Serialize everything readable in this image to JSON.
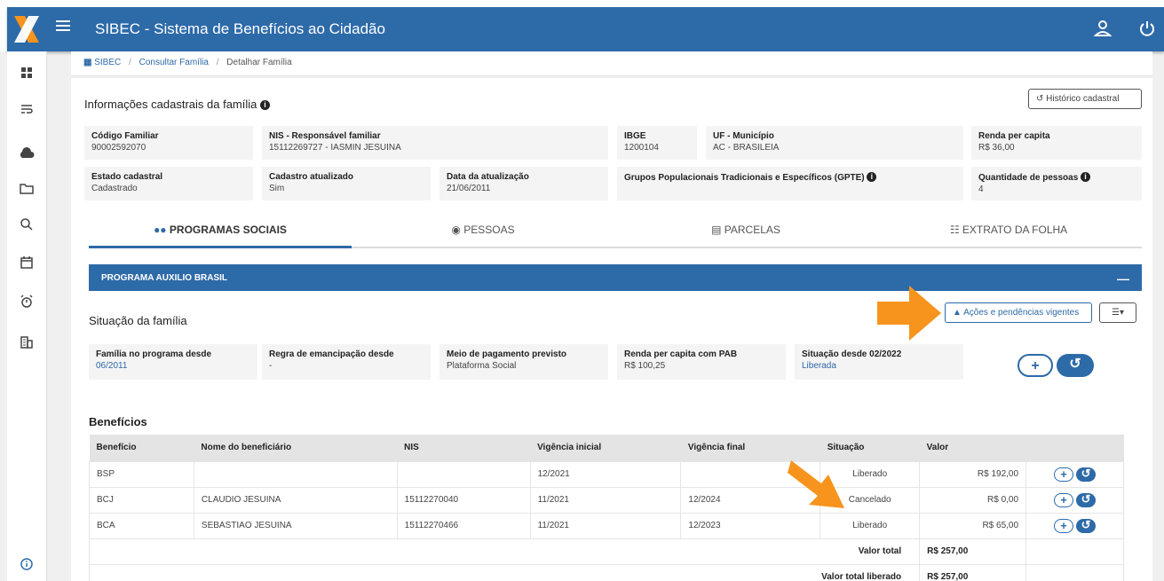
{
  "header": {
    "app_title": "SIBEC - Sistema de Benefícios ao Cidadão",
    "brand_colors": {
      "primary": "#2d6aa8",
      "accent": "#f7941d"
    }
  },
  "breadcrumb": {
    "items": [
      "SIBEC",
      "Consultar Família",
      "Detalhar Família"
    ]
  },
  "family_info": {
    "title": "Informações cadastrais da família",
    "history_button": "Histórico cadastral",
    "fields": {
      "codigo_familiar": {
        "label": "Código Familiar",
        "value": "90002592070"
      },
      "nis_responsavel": {
        "label": "NIS - Responsável familiar",
        "value": "15112269727 - IASMIN JESUINA"
      },
      "ibge": {
        "label": "IBGE",
        "value": "1200104"
      },
      "uf_municipio": {
        "label": "UF - Município",
        "value": "AC - BRASILEIA"
      },
      "renda_per_capita": {
        "label": "Renda per capita",
        "value": "R$ 36,00"
      },
      "estado_cadastral": {
        "label": "Estado cadastral",
        "value": "Cadastrado"
      },
      "cadastro_atualizado": {
        "label": "Cadastro atualizado",
        "value": "Sim"
      },
      "data_atualizacao": {
        "label": "Data da atualização",
        "value": "21/06/2011"
      },
      "gpte": {
        "label": "Grupos Populacionais Tradicionais e Específicos (GPTE)",
        "value": ""
      },
      "quantidade_pessoas": {
        "label": "Quantidade de pessoas",
        "value": "4"
      }
    }
  },
  "tabs": [
    {
      "label": "PROGRAMAS SOCIAIS",
      "icon": "users-icon",
      "active": true
    },
    {
      "label": "PESSOAS",
      "icon": "user-circle-icon",
      "active": false
    },
    {
      "label": "PARCELAS",
      "icon": "list-icon",
      "active": false
    },
    {
      "label": "EXTRATO DA FOLHA",
      "icon": "bank-icon",
      "active": false
    }
  ],
  "program": {
    "name": "PROGRAMA AUXILIO BRASIL",
    "collapse_symbol": "—",
    "situation_title": "Situação da família",
    "actions_button": "Ações e pendências vigentes",
    "fields": {
      "familia_desde": {
        "label": "Família no programa desde",
        "value": "06/2011"
      },
      "regra_emancipacao": {
        "label": "Regra de emancipação desde",
        "value": "-"
      },
      "meio_pagamento": {
        "label": "Meio de pagamento previsto",
        "value": "Plataforma Social"
      },
      "renda_pab": {
        "label": "Renda per capita com PAB",
        "value": "R$ 100,25"
      },
      "situacao_desde": {
        "label": "Situação desde 02/2022",
        "value": "Liberada"
      }
    }
  },
  "benefits": {
    "title": "Benefícios",
    "columns": [
      "Benefício",
      "Nome do beneficiário",
      "NIS",
      "Vigência inicial",
      "Vigência final",
      "Situação",
      "Valor"
    ],
    "rows": [
      {
        "beneficio": "BSP",
        "nome": "",
        "nis": "",
        "vig_inicial": "12/2021",
        "vig_final": "",
        "situacao": "Liberado",
        "valor": "R$ 192,00"
      },
      {
        "beneficio": "BCJ",
        "nome": "CLAUDIO JESUINA",
        "nis": "15112270040",
        "vig_inicial": "11/2021",
        "vig_final": "12/2024",
        "situacao": "Cancelado",
        "valor": "R$ 0,00"
      },
      {
        "beneficio": "BCA",
        "nome": "SEBASTIAO JESUINA",
        "nis": "15112270466",
        "vig_inicial": "11/2021",
        "vig_final": "12/2023",
        "situacao": "Liberado",
        "valor": "R$ 65,00"
      }
    ],
    "totals": {
      "total_label": "Valor total",
      "total_value": "R$ 257,00",
      "liberado_label": "Valor total liberado",
      "liberado_value": "R$ 257,00"
    }
  }
}
